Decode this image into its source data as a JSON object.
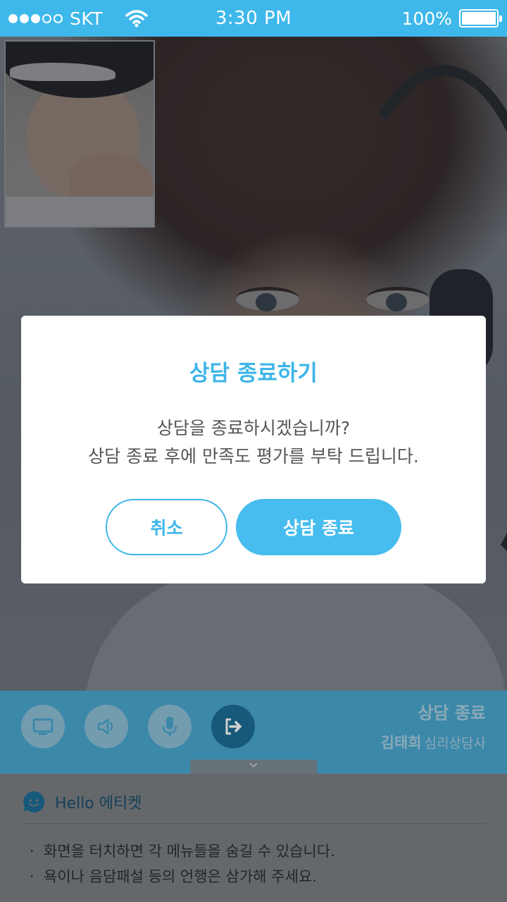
{
  "status_bar": {
    "carrier": "SKT",
    "time": "3:30 PM",
    "battery": "100%",
    "signal_bars_filled": 3,
    "signal_bars_total": 5,
    "battery_level": 1.0
  },
  "video": {
    "remote_feed": "counselor-video",
    "self_view": "self-video"
  },
  "controls": {
    "buttons": [
      "screen-share-icon",
      "speaker-icon",
      "microphone-icon",
      "exit-icon"
    ],
    "end_label": "상담 종료",
    "counselor_name": "김태희",
    "counselor_role": "심리상담사"
  },
  "info": {
    "title": "Hello 에티켓",
    "items": [
      "화면을 터치하면 각 메뉴들을 숨길 수 있습니다.",
      "욕이나 음담패설 등의 언행은 삼가해 주세요."
    ]
  },
  "modal": {
    "title": "상담 종료하기",
    "message_line1": "상담을 종료하시겠습니까?",
    "message_line2": "상담 종료 후에 만족도 평가를 부탁 드립니다.",
    "cancel_label": "취소",
    "confirm_label": "상담 종료"
  },
  "colors": {
    "accent": "#3db5e8",
    "status_bar": "#3eb8ea",
    "control_bar": "#4aa7cf"
  }
}
